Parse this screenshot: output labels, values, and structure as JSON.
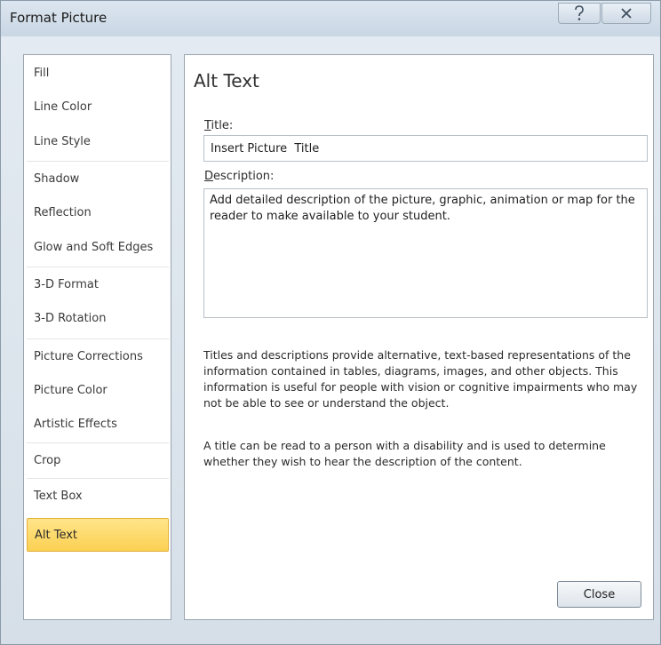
{
  "window": {
    "title": "Format Picture",
    "help_icon": "help-question-icon",
    "close_icon": "close-x-icon"
  },
  "sidebar": {
    "items": [
      {
        "label": "Fill"
      },
      {
        "label": "Line Color"
      },
      {
        "label": "Line Style"
      },
      {
        "label": "Shadow"
      },
      {
        "label": "Reflection"
      },
      {
        "label": "Glow and Soft Edges"
      },
      {
        "label": "3-D Format"
      },
      {
        "label": "3-D Rotation"
      },
      {
        "label": "Picture Corrections"
      },
      {
        "label": "Picture Color"
      },
      {
        "label": "Artistic Effects"
      },
      {
        "label": "Crop"
      },
      {
        "label": "Text Box"
      },
      {
        "label": "Alt Text"
      }
    ],
    "selected": "Alt Text",
    "selected_color": "#fcd55f"
  },
  "content": {
    "heading": "Alt Text",
    "title_label_accel": "T",
    "title_label_rest": "itle:",
    "title_value": "Insert Picture  Title",
    "description_label_accel": "D",
    "description_label_rest": "escription:",
    "description_value": "Add detailed description of the picture, graphic, animation or map for the reader to make available to your student.",
    "help_paragraph_1": "Titles and descriptions provide alternative, text-based representations of the information contained in tables, diagrams, images, and other objects. This information is useful for people with vision or cognitive impairments who may not be able to see or understand the object.",
    "help_paragraph_2": "A title can be read to a person with a disability and is used to determine whether they wish to hear the description of the content."
  },
  "footer": {
    "close_label": "Close"
  }
}
